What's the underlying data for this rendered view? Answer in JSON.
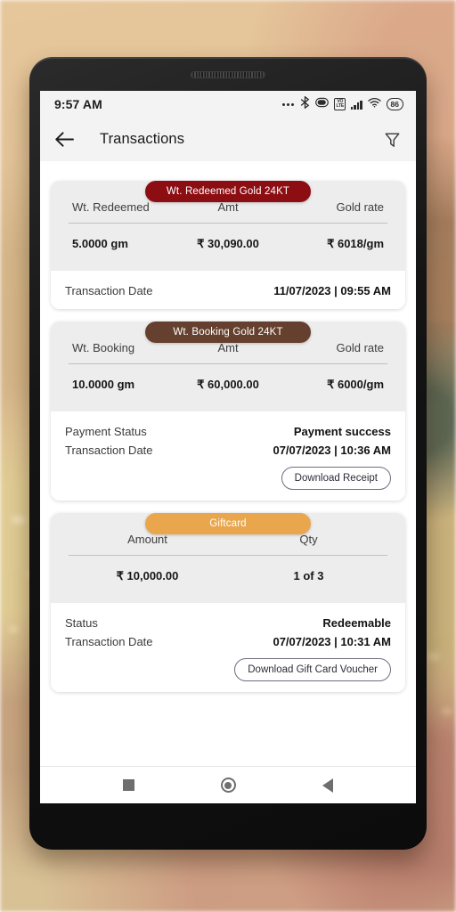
{
  "status_bar": {
    "time": "9:57 AM",
    "battery_percent": "86",
    "volte_line1": "VO",
    "volte_line2": "LTE",
    "icons": [
      "more-dots-icon",
      "bluetooth-icon",
      "data-saver-icon",
      "volte-icon",
      "signal-bars-icon",
      "wifi-icon",
      "battery-icon"
    ]
  },
  "app_bar": {
    "back_icon": "arrow-left-icon",
    "title": "Transactions",
    "filter_icon": "filter-icon"
  },
  "cards": [
    {
      "pill_label": "Wt. Redeemed Gold 24KT",
      "pill_color": "#8C0D12",
      "columns": 3,
      "headers": [
        "Wt. Redeemed",
        "Amt",
        "Gold rate"
      ],
      "values": [
        "5.0000 gm",
        "₹ 30,090.00",
        "₹ 6018/gm"
      ],
      "rows": [
        {
          "key": "Transaction Date",
          "value": "11/07/2023 | 09:55 AM"
        }
      ],
      "download_label": null
    },
    {
      "pill_label": "Wt. Booking Gold 24KT",
      "pill_color": "#66402E",
      "columns": 3,
      "headers": [
        "Wt. Booking",
        "Amt",
        "Gold rate"
      ],
      "values": [
        "10.0000 gm",
        "₹ 60,000.00",
        "₹ 6000/gm"
      ],
      "rows": [
        {
          "key": "Payment Status",
          "value": "Payment success"
        },
        {
          "key": "Transaction Date",
          "value": "07/07/2023 | 10:36 AM"
        }
      ],
      "download_label": "Download Receipt"
    },
    {
      "pill_label": "Giftcard",
      "pill_color": "#E9A64D",
      "columns": 2,
      "headers": [
        "Amount",
        "Qty"
      ],
      "values": [
        "₹ 10,000.00",
        "1 of 3"
      ],
      "rows": [
        {
          "key": "Status",
          "value": "Redeemable"
        },
        {
          "key": "Transaction Date",
          "value": "07/07/2023 | 10:31 AM"
        }
      ],
      "download_label": "Download Gift Card Voucher"
    }
  ],
  "nav_bar": {
    "recents_icon": "square-recents-icon",
    "home_icon": "circle-home-icon",
    "back_icon": "triangle-back-icon"
  }
}
